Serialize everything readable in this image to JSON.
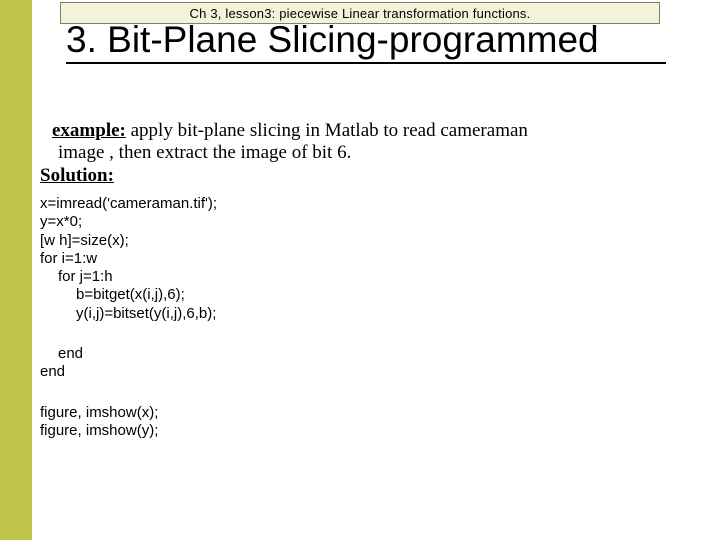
{
  "chapter_bar": "Ch 3, lesson3: piecewise Linear transformation functions.",
  "title": "3. Bit-Plane Slicing-programmed",
  "body": {
    "example_label": "example:",
    "example_text": " apply bit-plane  slicing in Matlab to read cameraman",
    "example_cont": "image , then extract the image of bit 6.",
    "solution_label": "Solution:"
  },
  "code": {
    "l1": "x=imread('cameraman.tif');",
    "l2": "y=x*0;",
    "l3": "[w h]=size(x);",
    "l4": "for i=1:w",
    "l5": "for j=1:h",
    "l6": "b=bitget(x(i,j),6);",
    "l7": "y(i,j)=bitset(y(i,j),6,b);",
    "end1": "end",
    "end2": "end",
    "fig1": "figure, imshow(x);",
    "fig2": "figure, imshow(y);"
  }
}
